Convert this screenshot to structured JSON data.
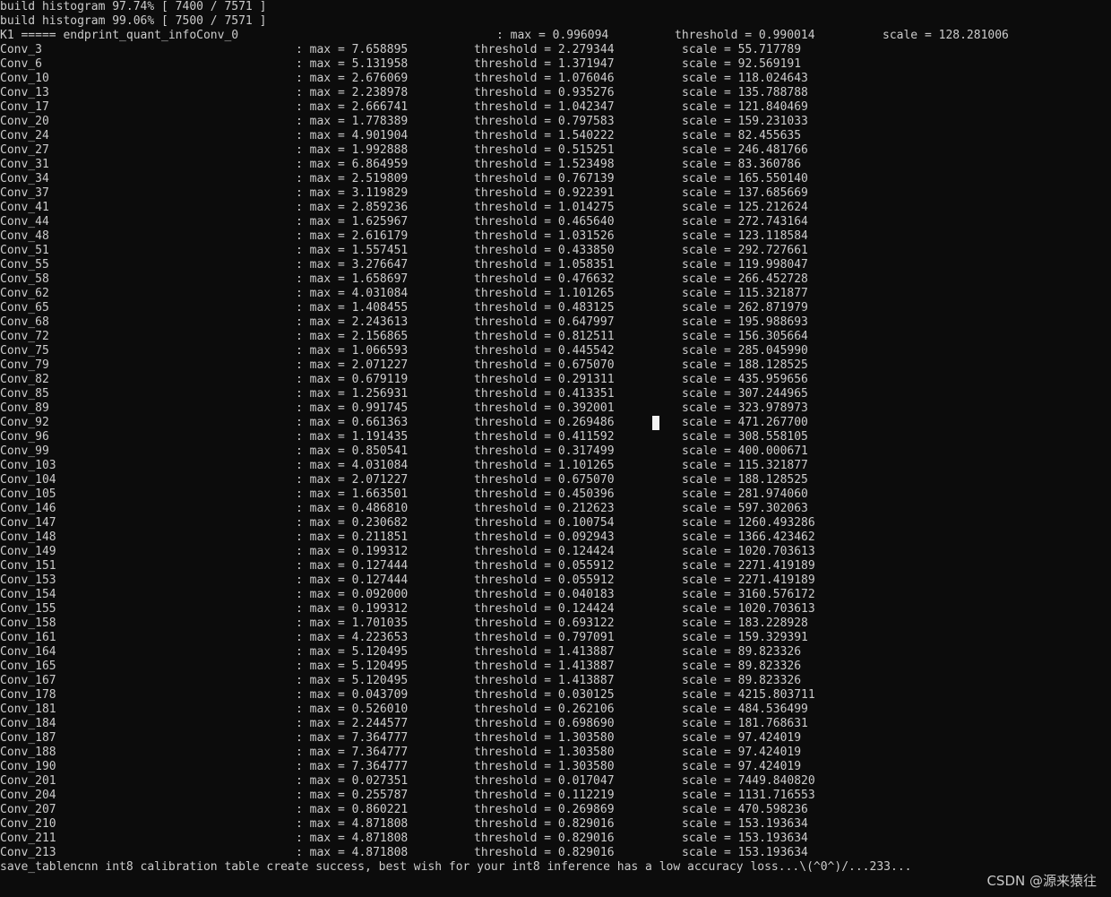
{
  "header": {
    "histogram_lines": [
      "build histogram 97.74% [ 7400 / 7571 ]",
      "build histogram 99.06% [ 7500 / 7571 ]"
    ],
    "k1": {
      "name": "K1 ===== endprint_quant_infoConv_0",
      "max": ": max = 0.996094",
      "threshold": "threshold = 0.990014",
      "scale": "scale = 128.281006"
    }
  },
  "rows": [
    {
      "name": "Conv_3",
      "max": ": max = 7.658895",
      "threshold": "threshold = 2.279344",
      "scale": "scale = 55.717789"
    },
    {
      "name": "Conv_6",
      "max": ": max = 5.131958",
      "threshold": "threshold = 1.371947",
      "scale": "scale = 92.569191"
    },
    {
      "name": "Conv_10",
      "max": ": max = 2.676069",
      "threshold": "threshold = 1.076046",
      "scale": "scale = 118.024643"
    },
    {
      "name": "Conv_13",
      "max": ": max = 2.238978",
      "threshold": "threshold = 0.935276",
      "scale": "scale = 135.788788"
    },
    {
      "name": "Conv_17",
      "max": ": max = 2.666741",
      "threshold": "threshold = 1.042347",
      "scale": "scale = 121.840469"
    },
    {
      "name": "Conv_20",
      "max": ": max = 1.778389",
      "threshold": "threshold = 0.797583",
      "scale": "scale = 159.231033"
    },
    {
      "name": "Conv_24",
      "max": ": max = 4.901904",
      "threshold": "threshold = 1.540222",
      "scale": "scale = 82.455635"
    },
    {
      "name": "Conv_27",
      "max": ": max = 1.992888",
      "threshold": "threshold = 0.515251",
      "scale": "scale = 246.481766"
    },
    {
      "name": "Conv_31",
      "max": ": max = 6.864959",
      "threshold": "threshold = 1.523498",
      "scale": "scale = 83.360786"
    },
    {
      "name": "Conv_34",
      "max": ": max = 2.519809",
      "threshold": "threshold = 0.767139",
      "scale": "scale = 165.550140"
    },
    {
      "name": "Conv_37",
      "max": ": max = 3.119829",
      "threshold": "threshold = 0.922391",
      "scale": "scale = 137.685669"
    },
    {
      "name": "Conv_41",
      "max": ": max = 2.859236",
      "threshold": "threshold = 1.014275",
      "scale": "scale = 125.212624"
    },
    {
      "name": "Conv_44",
      "max": ": max = 1.625967",
      "threshold": "threshold = 0.465640",
      "scale": "scale = 272.743164"
    },
    {
      "name": "Conv_48",
      "max": ": max = 2.616179",
      "threshold": "threshold = 1.031526",
      "scale": "scale = 123.118584"
    },
    {
      "name": "Conv_51",
      "max": ": max = 1.557451",
      "threshold": "threshold = 0.433850",
      "scale": "scale = 292.727661"
    },
    {
      "name": "Conv_55",
      "max": ": max = 3.276647",
      "threshold": "threshold = 1.058351",
      "scale": "scale = 119.998047"
    },
    {
      "name": "Conv_58",
      "max": ": max = 1.658697",
      "threshold": "threshold = 0.476632",
      "scale": "scale = 266.452728"
    },
    {
      "name": "Conv_62",
      "max": ": max = 4.031084",
      "threshold": "threshold = 1.101265",
      "scale": "scale = 115.321877"
    },
    {
      "name": "Conv_65",
      "max": ": max = 1.408455",
      "threshold": "threshold = 0.483125",
      "scale": "scale = 262.871979"
    },
    {
      "name": "Conv_68",
      "max": ": max = 2.243613",
      "threshold": "threshold = 0.647997",
      "scale": "scale = 195.988693"
    },
    {
      "name": "Conv_72",
      "max": ": max = 2.156865",
      "threshold": "threshold = 0.812511",
      "scale": "scale = 156.305664"
    },
    {
      "name": "Conv_75",
      "max": ": max = 1.066593",
      "threshold": "threshold = 0.445542",
      "scale": "scale = 285.045990"
    },
    {
      "name": "Conv_79",
      "max": ": max = 2.071227",
      "threshold": "threshold = 0.675070",
      "scale": "scale = 188.128525"
    },
    {
      "name": "Conv_82",
      "max": ": max = 0.679119",
      "threshold": "threshold = 0.291311",
      "scale": "scale = 435.959656"
    },
    {
      "name": "Conv_85",
      "max": ": max = 1.256931",
      "threshold": "threshold = 0.413351",
      "scale": "scale = 307.244965"
    },
    {
      "name": "Conv_89",
      "max": ": max = 0.991745",
      "threshold": "threshold = 0.392001",
      "scale": "scale = 323.978973"
    },
    {
      "name": "Conv_92",
      "max": ": max = 0.661363",
      "threshold": "threshold = 0.269486",
      "scale": "scale = 471.267700"
    },
    {
      "name": "Conv_96",
      "max": ": max = 1.191435",
      "threshold": "threshold = 0.411592",
      "scale": "scale = 308.558105"
    },
    {
      "name": "Conv_99",
      "max": ": max = 0.850541",
      "threshold": "threshold = 0.317499",
      "scale": "scale = 400.000671"
    },
    {
      "name": "Conv_103",
      "max": ": max = 4.031084",
      "threshold": "threshold = 1.101265",
      "scale": "scale = 115.321877"
    },
    {
      "name": "Conv_104",
      "max": ": max = 2.071227",
      "threshold": "threshold = 0.675070",
      "scale": "scale = 188.128525"
    },
    {
      "name": "Conv_105",
      "max": ": max = 1.663501",
      "threshold": "threshold = 0.450396",
      "scale": "scale = 281.974060"
    },
    {
      "name": "Conv_146",
      "max": ": max = 0.486810",
      "threshold": "threshold = 0.212623",
      "scale": "scale = 597.302063"
    },
    {
      "name": "Conv_147",
      "max": ": max = 0.230682",
      "threshold": "threshold = 0.100754",
      "scale": "scale = 1260.493286"
    },
    {
      "name": "Conv_148",
      "max": ": max = 0.211851",
      "threshold": "threshold = 0.092943",
      "scale": "scale = 1366.423462"
    },
    {
      "name": "Conv_149",
      "max": ": max = 0.199312",
      "threshold": "threshold = 0.124424",
      "scale": "scale = 1020.703613"
    },
    {
      "name": "Conv_151",
      "max": ": max = 0.127444",
      "threshold": "threshold = 0.055912",
      "scale": "scale = 2271.419189"
    },
    {
      "name": "Conv_153",
      "max": ": max = 0.127444",
      "threshold": "threshold = 0.055912",
      "scale": "scale = 2271.419189"
    },
    {
      "name": "Conv_154",
      "max": ": max = 0.092000",
      "threshold": "threshold = 0.040183",
      "scale": "scale = 3160.576172"
    },
    {
      "name": "Conv_155",
      "max": ": max = 0.199312",
      "threshold": "threshold = 0.124424",
      "scale": "scale = 1020.703613"
    },
    {
      "name": "Conv_158",
      "max": ": max = 1.701035",
      "threshold": "threshold = 0.693122",
      "scale": "scale = 183.228928"
    },
    {
      "name": "Conv_161",
      "max": ": max = 4.223653",
      "threshold": "threshold = 0.797091",
      "scale": "scale = 159.329391"
    },
    {
      "name": "Conv_164",
      "max": ": max = 5.120495",
      "threshold": "threshold = 1.413887",
      "scale": "scale = 89.823326"
    },
    {
      "name": "Conv_165",
      "max": ": max = 5.120495",
      "threshold": "threshold = 1.413887",
      "scale": "scale = 89.823326"
    },
    {
      "name": "Conv_167",
      "max": ": max = 5.120495",
      "threshold": "threshold = 1.413887",
      "scale": "scale = 89.823326"
    },
    {
      "name": "Conv_178",
      "max": ": max = 0.043709",
      "threshold": "threshold = 0.030125",
      "scale": "scale = 4215.803711"
    },
    {
      "name": "Conv_181",
      "max": ": max = 0.526010",
      "threshold": "threshold = 0.262106",
      "scale": "scale = 484.536499"
    },
    {
      "name": "Conv_184",
      "max": ": max = 2.244577",
      "threshold": "threshold = 0.698690",
      "scale": "scale = 181.768631"
    },
    {
      "name": "Conv_187",
      "max": ": max = 7.364777",
      "threshold": "threshold = 1.303580",
      "scale": "scale = 97.424019"
    },
    {
      "name": "Conv_188",
      "max": ": max = 7.364777",
      "threshold": "threshold = 1.303580",
      "scale": "scale = 97.424019"
    },
    {
      "name": "Conv_190",
      "max": ": max = 7.364777",
      "threshold": "threshold = 1.303580",
      "scale": "scale = 97.424019"
    },
    {
      "name": "Conv_201",
      "max": ": max = 0.027351",
      "threshold": "threshold = 0.017047",
      "scale": "scale = 7449.840820"
    },
    {
      "name": "Conv_204",
      "max": ": max = 0.255787",
      "threshold": "threshold = 0.112219",
      "scale": "scale = 1131.716553"
    },
    {
      "name": "Conv_207",
      "max": ": max = 0.860221",
      "threshold": "threshold = 0.269869",
      "scale": "scale = 470.598236"
    },
    {
      "name": "Conv_210",
      "max": ": max = 4.871808",
      "threshold": "threshold = 0.829016",
      "scale": "scale = 153.193634"
    },
    {
      "name": "Conv_211",
      "max": ": max = 4.871808",
      "threshold": "threshold = 0.829016",
      "scale": "scale = 153.193634"
    },
    {
      "name": "Conv_213",
      "max": ": max = 4.871808",
      "threshold": "threshold = 0.829016",
      "scale": "scale = 153.193634"
    }
  ],
  "footer": {
    "message": "save_tablencnn int8 calibration table create success, best wish for your int8 inference has a low accuracy loss...\\(^0^)/...233..."
  },
  "watermark": "CSDN @源来猿往",
  "colors": {
    "background": "#0c0c0c",
    "text": "#cccccc",
    "cursor": "#f2f2f2"
  }
}
